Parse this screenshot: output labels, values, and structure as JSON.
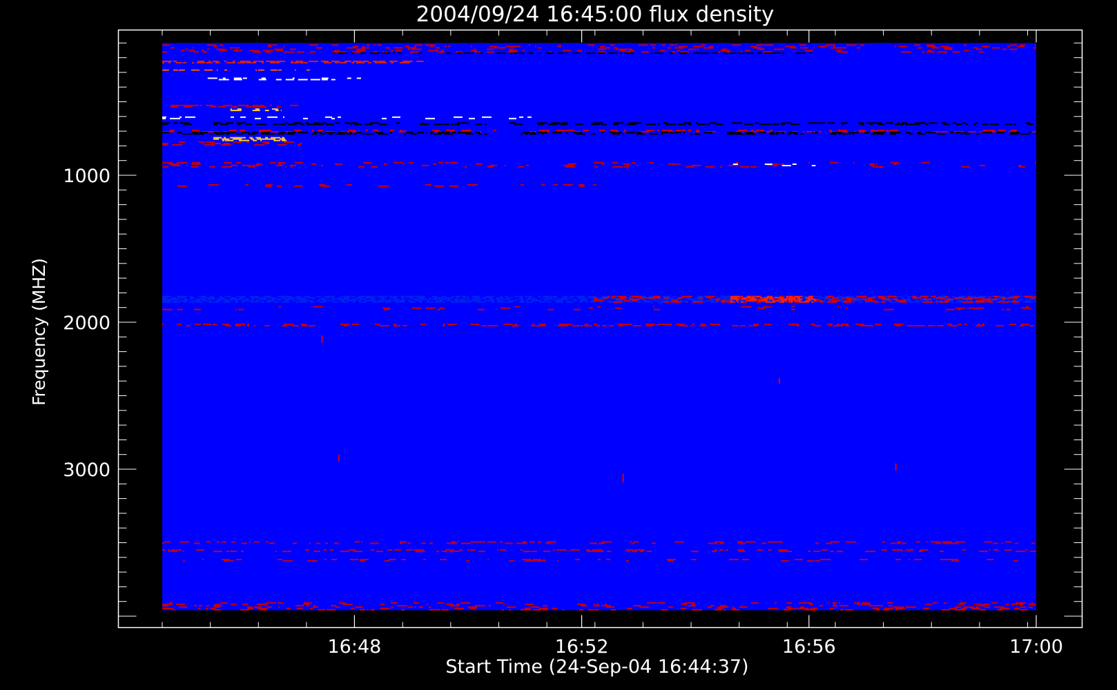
{
  "chart_data": {
    "type": "heatmap",
    "title": "2004/09/24 16:45:00 flux density",
    "xlabel": "Start Time (24-Sep-04 16:44:37)",
    "ylabel": "Frequency (MHZ)",
    "x_ticks": [
      "16:48",
      "16:52",
      "16:56",
      "17:00"
    ],
    "x_tick_minutes": [
      3.383,
      7.383,
      11.383,
      15.383
    ],
    "x_range_minutes": [
      0,
      15.383
    ],
    "y_ticks": [
      "1000",
      "2000",
      "3000"
    ],
    "y_tick_values": [
      1000,
      2000,
      3000
    ],
    "ylim": [
      4100,
      0
    ],
    "data_freq_range": [
      100,
      3960
    ],
    "grid": false,
    "background_color": "#0000ff",
    "colors": {
      "background": "#000000",
      "axes": "#ffffff",
      "low": "#0000ff",
      "mid": "#cc0000",
      "high": "#ffffff"
    },
    "colorscale": [
      "#000000",
      "#0000ff",
      "#cc0000",
      "#ffcc33",
      "#ffffff"
    ],
    "features": [
      {
        "kind": "band",
        "f0": 110,
        "f1": 165,
        "t0": 0,
        "t1": 15.38,
        "color": "#cc0000",
        "density": 0.35
      },
      {
        "kind": "band",
        "f0": 165,
        "f1": 175,
        "t0": 3.0,
        "t1": 11.5,
        "color": "#000000",
        "density": 0.9
      },
      {
        "kind": "band",
        "f0": 220,
        "f1": 235,
        "t0": 0,
        "t1": 4.6,
        "color": "#dd2200",
        "density": 0.9
      },
      {
        "kind": "band",
        "f0": 280,
        "f1": 292,
        "t0": 0,
        "t1": 2.6,
        "color": "#ff5500",
        "density": 0.9
      },
      {
        "kind": "band",
        "f0": 335,
        "f1": 350,
        "t0": 0.8,
        "t1": 3.5,
        "color": "#ffffff",
        "density": 0.6
      },
      {
        "kind": "band",
        "f0": 520,
        "f1": 540,
        "t0": 0,
        "t1": 2.4,
        "color": "#cc0000",
        "density": 0.7
      },
      {
        "kind": "band",
        "f0": 545,
        "f1": 560,
        "t0": 1.2,
        "t1": 2.1,
        "color": "#ffcc33",
        "density": 0.8
      },
      {
        "kind": "band",
        "f0": 600,
        "f1": 620,
        "t0": 0,
        "t1": 6.5,
        "color": "#ffffff",
        "density": 0.4
      },
      {
        "kind": "band",
        "f0": 640,
        "f1": 660,
        "t0": 0,
        "t1": 15.38,
        "color": "#000000",
        "density": 0.6
      },
      {
        "kind": "band",
        "f0": 690,
        "f1": 705,
        "t0": 0,
        "t1": 15.38,
        "color": "#cc0000",
        "density": 0.5
      },
      {
        "kind": "band",
        "f0": 705,
        "f1": 720,
        "t0": 0,
        "t1": 15.38,
        "color": "#000000",
        "density": 0.7
      },
      {
        "kind": "band",
        "f0": 740,
        "f1": 770,
        "t0": 0.9,
        "t1": 2.2,
        "color": "#ffcc33",
        "density": 0.85
      },
      {
        "kind": "band",
        "f0": 770,
        "f1": 800,
        "t0": 0,
        "t1": 2.5,
        "color": "#cc0000",
        "density": 0.5
      },
      {
        "kind": "band",
        "f0": 910,
        "f1": 945,
        "t0": 0,
        "t1": 15.38,
        "color": "#cc0000",
        "density": 0.25
      },
      {
        "kind": "band",
        "f0": 920,
        "f1": 935,
        "t0": 9.5,
        "t1": 11.5,
        "color": "#ffffff",
        "density": 0.35
      },
      {
        "kind": "band",
        "f0": 1060,
        "f1": 1080,
        "t0": 0,
        "t1": 8.0,
        "color": "#cc0000",
        "density": 0.15
      },
      {
        "kind": "band",
        "f0": 1820,
        "f1": 1870,
        "t0": 0,
        "t1": 15.38,
        "color": "#0022ee",
        "density": 1.0
      },
      {
        "kind": "band",
        "f0": 1820,
        "f1": 1870,
        "t0": 7.6,
        "t1": 15.38,
        "color": "#dd0000",
        "density": 0.55
      },
      {
        "kind": "band",
        "f0": 1820,
        "f1": 1870,
        "t0": 10.0,
        "t1": 11.5,
        "color": "#ff2200",
        "density": 0.9
      },
      {
        "kind": "band",
        "f0": 1890,
        "f1": 1920,
        "t0": 0,
        "t1": 15.38,
        "color": "#cc0000",
        "density": 0.15
      },
      {
        "kind": "band",
        "f0": 2010,
        "f1": 2030,
        "t0": 0,
        "t1": 15.38,
        "color": "#cc0000",
        "density": 0.55
      },
      {
        "kind": "band",
        "f0": 3490,
        "f1": 3510,
        "t0": 0,
        "t1": 15.38,
        "color": "#cc0000",
        "density": 0.4
      },
      {
        "kind": "band",
        "f0": 3545,
        "f1": 3560,
        "t0": 0,
        "t1": 15.38,
        "color": "#cc0000",
        "density": 0.45
      },
      {
        "kind": "band",
        "f0": 3610,
        "f1": 3625,
        "t0": 0,
        "t1": 15.38,
        "color": "#cc0000",
        "density": 0.3
      },
      {
        "kind": "band",
        "f0": 3905,
        "f1": 3960,
        "t0": 0,
        "t1": 15.38,
        "color": "#cc0000",
        "density": 0.35
      },
      {
        "kind": "spike",
        "f0": 2090,
        "f1": 2140,
        "t": 2.8,
        "color": "#dd0000"
      },
      {
        "kind": "spike",
        "f0": 2900,
        "f1": 2950,
        "t": 3.1,
        "color": "#dd0000"
      },
      {
        "kind": "spike",
        "f0": 3030,
        "f1": 3090,
        "t": 8.1,
        "color": "#dd0000"
      },
      {
        "kind": "spike",
        "f0": 2380,
        "f1": 2420,
        "t": 10.85,
        "color": "#dd0000"
      },
      {
        "kind": "spike",
        "f0": 2960,
        "f1": 3010,
        "t": 12.9,
        "color": "#dd0000"
      }
    ]
  }
}
